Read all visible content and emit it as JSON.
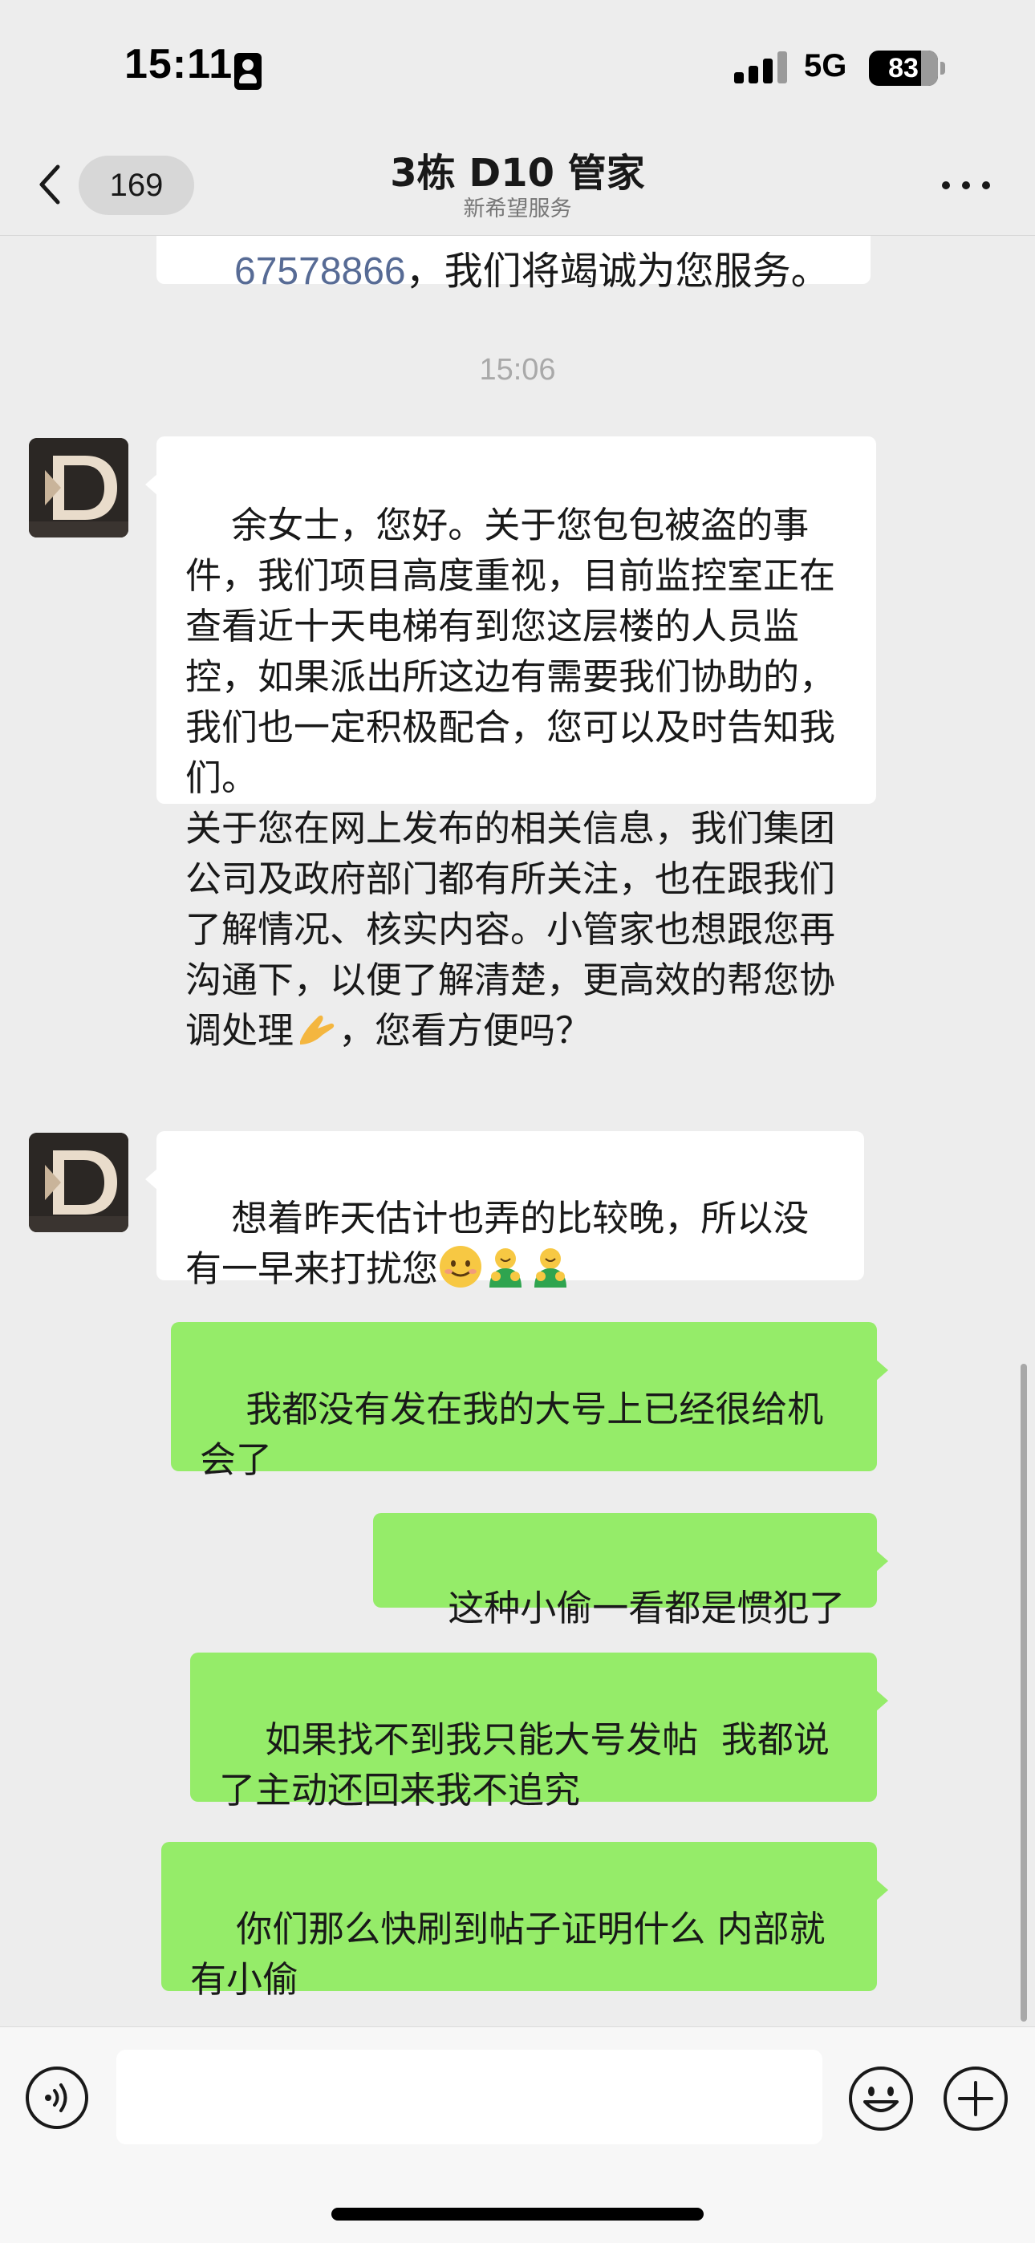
{
  "status_bar": {
    "time": "15:11",
    "network": "5G",
    "battery": "83"
  },
  "nav": {
    "unread_count": "169",
    "title": "3栋 D10 管家",
    "subtitle": "新希望服务"
  },
  "messages": {
    "previous_fragment_number": "67578866",
    "previous_fragment_text": "，我们将竭诚为您服务。",
    "timestamp": "15:06",
    "msg1": "余女士，您好。关于您包包被盗的事件，我们项目高度重视，目前监控室正在查看近十天电梯有到您这层楼的人员监控，如果派出所这边有需要我们协助的，我们也一定积极配合，您可以及时告知我们。\n关于您在网上发布的相关信息，我们集团公司及政府部门都有所关注，也在跟我们了解情况、核实内容。小管家也想跟您再沟通下，以便了解清楚，更高效的帮您协调处理",
    "msg1_tail": "，您看方便吗？",
    "msg2": "想着昨天估计也弄的比较晚，所以没有一早来打扰您",
    "msg3": "我都没有发在我的大号上已经很给机会了",
    "msg4": "这种小偷一看都是惯犯了",
    "msg5": "如果找不到我只能大号发帖  我都说了主动还回来我不追究",
    "msg6": "你们那么快刷到帖子证明什么 内部就有小偷"
  },
  "icons": {
    "back": "chevron-left-icon",
    "more": "more-dots-icon",
    "voice": "voice-icon",
    "emoji": "smiley-icon",
    "plus": "plus-circle-icon"
  },
  "colors": {
    "background": "#ededed",
    "sent_bubble": "#95ec69",
    "received_bubble": "#ffffff",
    "link": "#576b95"
  }
}
